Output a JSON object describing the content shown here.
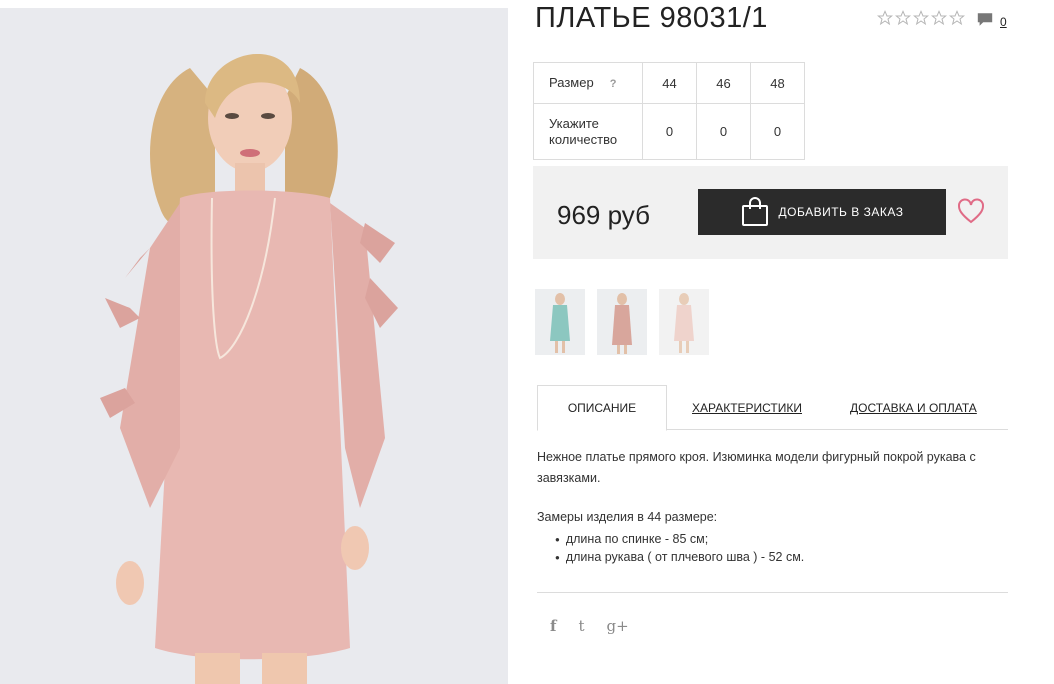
{
  "product": {
    "title": "ПЛАТЬЕ 98031/1",
    "rating_stars": 5,
    "rating_value": 0,
    "comments_count": "0"
  },
  "size_table": {
    "size_label": "Размер",
    "help": "?",
    "quantity_label": "Укажите количество",
    "sizes": [
      "44",
      "46",
      "48"
    ],
    "quantities": [
      "0",
      "0",
      "0"
    ]
  },
  "price_box": {
    "price": "969 руб",
    "order_button": "ДОБАВИТЬ В ЗАКАЗ"
  },
  "thumbnails": [
    {
      "name": "mint dress"
    },
    {
      "name": "pink dress"
    },
    {
      "name": "light pink dress"
    }
  ],
  "tabs": {
    "description": "ОПИСАНИЕ",
    "characteristics": "ХАРАКТЕРИСТИКИ",
    "delivery": "ДОСТАВКА И ОПЛАТА"
  },
  "description": {
    "text": "Нежное платье прямого кроя. Изюминка модели фигурный покрой рукава с завязками.",
    "measures_title": "Замеры изделия в 44 размере:",
    "measures": [
      "длина по спинке - 85 см;",
      "длина рукава ( от плчевого шва ) - 52 см."
    ]
  },
  "social": {
    "facebook": "f",
    "twitter": "t",
    "google": "g+"
  },
  "colors": {
    "button_bg": "#2b2b2b",
    "heart": "#e06b86",
    "price_box_bg": "#f1f1f1",
    "dress": "#e8b8b2"
  }
}
